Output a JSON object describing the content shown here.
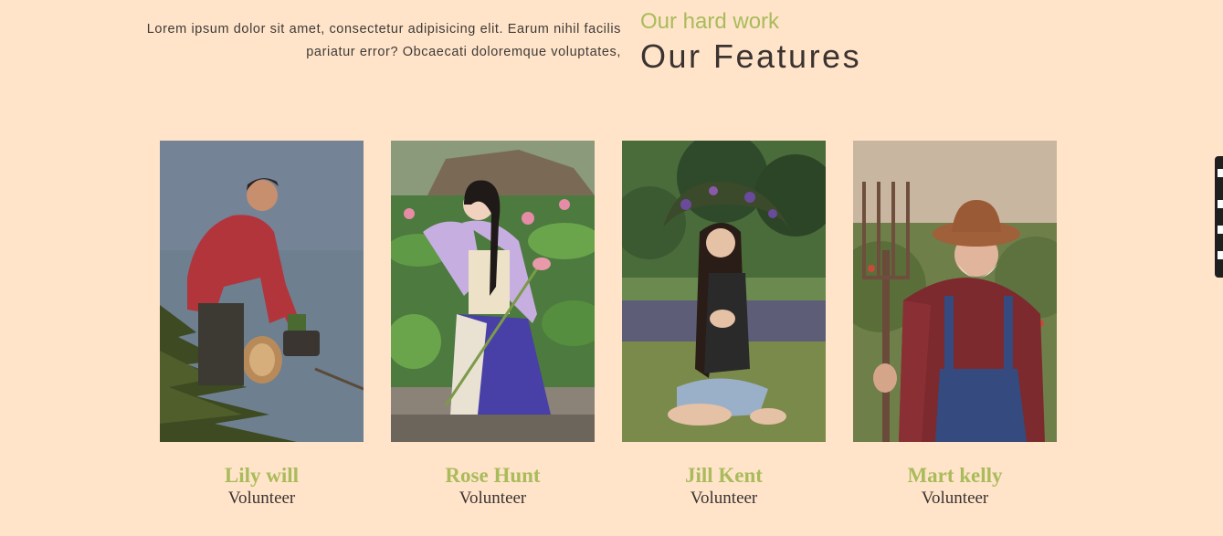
{
  "intro": {
    "text": "Lorem ipsum dolor sit amet, consectetur adipisicing elit. Earum nihil facilis pariatur error? Obcaecati doloremque voluptates,"
  },
  "section": {
    "subtitle": "Our hard work",
    "title": "Our Features"
  },
  "team": [
    {
      "name": "Lily will",
      "role": "Volunteer"
    },
    {
      "name": "Rose Hunt",
      "role": "Volunteer"
    },
    {
      "name": "Jill Kent",
      "role": "Volunteer"
    },
    {
      "name": "Mart kelly",
      "role": "Volunteer"
    }
  ],
  "colors": {
    "background": "#ffe4ca",
    "accent": "#a9bb5a",
    "text": "#3b3330"
  },
  "side_toolbar": {
    "icons": [
      "pin-icon",
      "window-icon",
      "copy-icon",
      "settings-icon"
    ]
  }
}
